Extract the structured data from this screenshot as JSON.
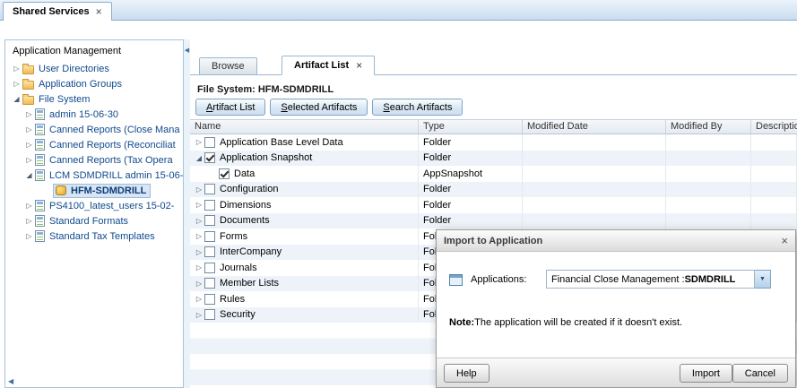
{
  "window_tab": {
    "label": "Shared Services",
    "close_glyph": "×"
  },
  "sidebar": {
    "title": "Application Management",
    "hscroll_left_glyph": "◀",
    "tree": [
      {
        "label": "User Directories",
        "caret": "▷"
      },
      {
        "label": "Application Groups",
        "caret": "▷"
      },
      {
        "label": "File System",
        "caret": "◢"
      },
      {
        "label": "admin 15-06-30",
        "caret": "▷"
      },
      {
        "label": "Canned Reports (Close Mana",
        "caret": "▷"
      },
      {
        "label": "Canned Reports (Reconciliat",
        "caret": "▷"
      },
      {
        "label": "Canned Reports (Tax Opera",
        "caret": "▷"
      },
      {
        "label": "LCM SDMDRILL admin 15-06-",
        "caret": "◢"
      },
      {
        "label": "HFM-SDMDRILL",
        "selected": true
      },
      {
        "label": "PS4100_latest_users 15-02-",
        "caret": "▷"
      },
      {
        "label": "Standard Formats",
        "caret": "▷"
      },
      {
        "label": "Standard Tax Templates",
        "caret": "▷"
      }
    ]
  },
  "splitter": {
    "collapse_glyph": "◀"
  },
  "content": {
    "tabs": {
      "browse": "Browse",
      "artifact_list": "Artifact List",
      "close_glyph": "×"
    },
    "file_system_label": "File System: HFM-SDMDRILL",
    "toolbar": {
      "artifact_list": "Artifact List",
      "selected_artifacts": "Selected Artifacts",
      "search_artifacts": "Search Artifacts"
    }
  },
  "table": {
    "columns": [
      "Name",
      "Type",
      "Modified Date",
      "Modified By",
      "Description"
    ],
    "rows": [
      {
        "name": "Application Base Level Data",
        "type": "Folder",
        "caret": "▷"
      },
      {
        "name": "Application Snapshot",
        "type": "Folder",
        "caret": "◢",
        "checked": true
      },
      {
        "name": "Data",
        "type": "AppSnapshot",
        "checked": true
      },
      {
        "name": "Configuration",
        "type": "Folder",
        "caret": "▷"
      },
      {
        "name": "Dimensions",
        "type": "Folder",
        "caret": "▷"
      },
      {
        "name": "Documents",
        "type": "Folder",
        "caret": "▷"
      },
      {
        "name": "Forms",
        "type": "Folder",
        "caret": "▷"
      },
      {
        "name": "InterCompany",
        "type": "Folder",
        "caret": "▷"
      },
      {
        "name": "Journals",
        "type": "Folder",
        "caret": "▷"
      },
      {
        "name": "Member Lists",
        "type": "Folder",
        "caret": "▷"
      },
      {
        "name": "Rules",
        "type": "Folder",
        "caret": "▷"
      },
      {
        "name": "Security",
        "type": "Folder",
        "caret": "▷"
      }
    ]
  },
  "dialog": {
    "title": "Import to Application",
    "close_glyph": "×",
    "applications_label": "Applications:",
    "dropdown_value_prefix": "Financial Close Management : ",
    "dropdown_value_bold": "SDMDRILL",
    "dropdown_arrow_glyph": "▼",
    "note_label": "Note:",
    "note_text": "The application will be created if it doesn't exist.",
    "buttons": {
      "help": "Help",
      "import": "Import",
      "cancel": "Cancel"
    }
  }
}
